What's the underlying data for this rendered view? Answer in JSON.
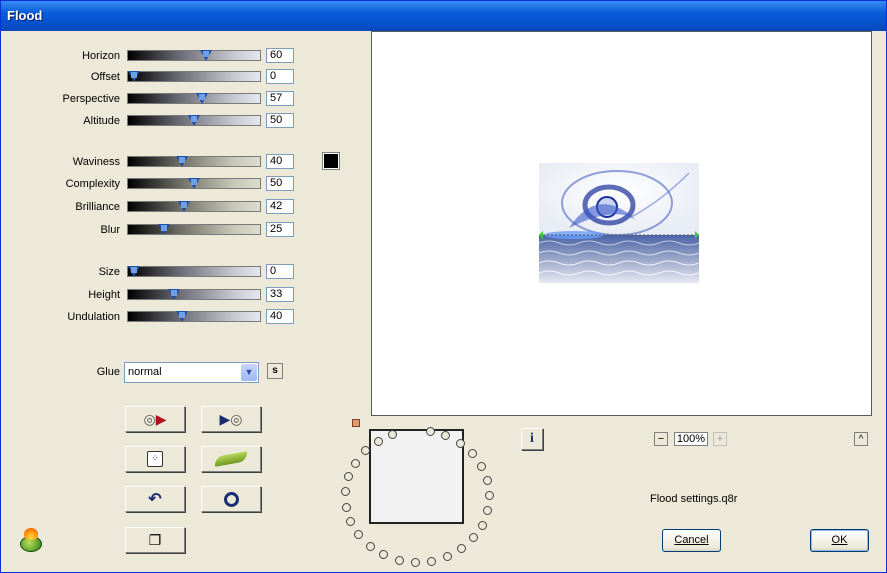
{
  "window": {
    "title": "Flood"
  },
  "sliders_group1": [
    {
      "label": "Horizon",
      "value": "60",
      "level": 0.6
    },
    {
      "label": "Offset",
      "value": "0",
      "level": 0.0
    },
    {
      "label": "Perspective",
      "value": "57",
      "level": 0.57
    },
    {
      "label": "Altitude",
      "value": "50",
      "level": 0.5
    }
  ],
  "sliders_group2": [
    {
      "label": "Waviness",
      "value": "40",
      "level": 0.4
    },
    {
      "label": "Complexity",
      "value": "50",
      "level": 0.5
    },
    {
      "label": "Brilliance",
      "value": "42",
      "level": 0.42
    },
    {
      "label": "Blur",
      "value": "25",
      "level": 0.25
    }
  ],
  "sliders_group3": [
    {
      "label": "Size",
      "value": "0",
      "level": 0.0
    },
    {
      "label": "Height",
      "value": "33",
      "level": 0.33
    },
    {
      "label": "Undulation",
      "value": "40",
      "level": 0.4
    }
  ],
  "color_swatch": "#000000",
  "glue": {
    "label": "Glue",
    "selected": "normal",
    "side_button": "s"
  },
  "preview": {
    "zoom": "100%",
    "info_label": "i",
    "up_label": "^"
  },
  "settings_file": "Flood settings.q8r",
  "buttons": {
    "cancel": "Cancel",
    "ok": "OK"
  }
}
